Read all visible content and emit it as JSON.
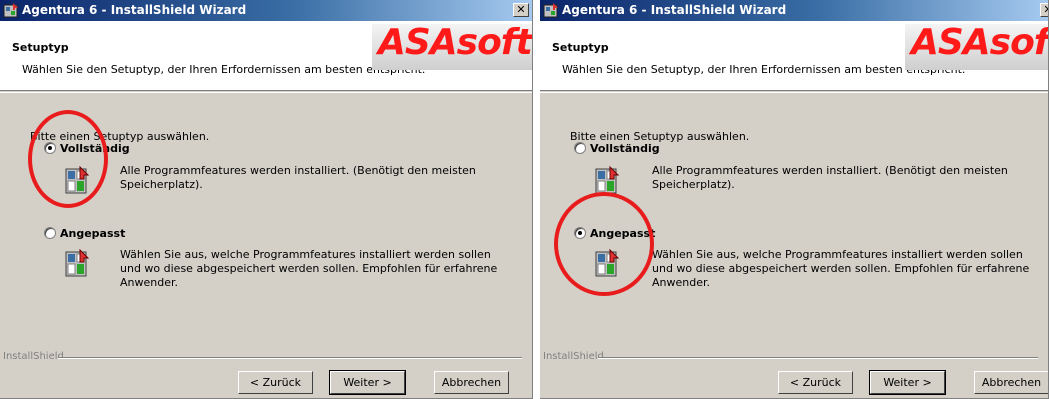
{
  "windows": [
    {
      "title": "Agentura 6 - InstallShield Wizard",
      "close": "✕",
      "header_title": "Setuptyp",
      "header_desc": "Wählen Sie den Setuptyp, der Ihren Erfordernissen am besten entspricht.",
      "logo": "ASAsoft",
      "prompt": "Bitte einen Setuptyp auswählen.",
      "options": [
        {
          "label": "Vollständig",
          "selected": true,
          "desc1": "Alle Programmfeatures werden installiert. (Benötigt den meisten",
          "desc2": "Speicherplatz).",
          "desc3": ""
        },
        {
          "label": "Angepasst",
          "selected": false,
          "desc1": "Wählen Sie aus, welche Programmfeatures installiert werden sollen",
          "desc2": "und wo diese abgespeichert werden sollen. Empfohlen für erfahrene",
          "desc3": "Anwender."
        }
      ],
      "brand": "InstallShield",
      "buttons": {
        "back": "< Zurück",
        "next": "Weiter >",
        "cancel": "Abbrechen"
      }
    },
    {
      "title": "Agentura 6 - InstallShield Wizard",
      "close": "✕",
      "header_title": "Setuptyp",
      "header_desc": "Wählen Sie den Setuptyp, der Ihren Erfordernissen am besten entspricht.",
      "logo": "ASAsoft",
      "prompt": "Bitte einen Setuptyp auswählen.",
      "options": [
        {
          "label": "Vollständig",
          "selected": false,
          "desc1": "Alle Programmfeatures werden installiert. (Benötigt den meisten",
          "desc2": "Speicherplatz).",
          "desc3": ""
        },
        {
          "label": "Angepasst",
          "selected": true,
          "desc1": "Wählen Sie aus, welche Programmfeatures installiert werden sollen",
          "desc2": "und wo diese abgespeichert werden sollen. Empfohlen für erfahrene",
          "desc3": "Anwender."
        }
      ],
      "brand": "InstallShield",
      "buttons": {
        "back": "< Zurück",
        "next": "Weiter >",
        "cancel": "Abbrechen"
      }
    }
  ],
  "colors": {
    "titlebar_start": "#0a246a",
    "titlebar_end": "#a6caf0",
    "annotation_circle": "#e81c1c",
    "logo_text": "#ff1a1a",
    "dialog_bg": "#d4d0c8"
  },
  "icons": {
    "app": "installer-app-icon",
    "option": "setup-package-icon"
  }
}
